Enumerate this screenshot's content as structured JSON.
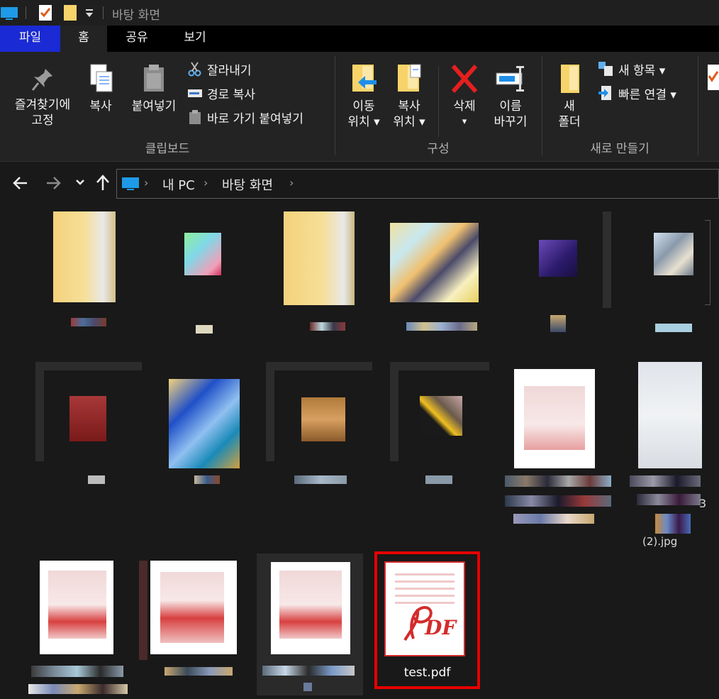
{
  "window": {
    "title": "바탕 화면"
  },
  "tabs": {
    "file": "파일",
    "home": "홈",
    "share": "공유",
    "view": "보기"
  },
  "ribbon": {
    "pin_label_1": "즐겨찾기에",
    "pin_label_2": "고정",
    "copy": "복사",
    "paste": "붙여넣기",
    "cut": "잘라내기",
    "copy_path": "경로 복사",
    "paste_shortcut": "바로 가기 붙여넣기",
    "clipboard_group": "클립보드",
    "move_to_1": "이동",
    "move_to_2": "위치 ▾",
    "copy_to_1": "복사",
    "copy_to_2": "위치 ▾",
    "delete": "삭제",
    "delete_arrow": "▾",
    "rename_1": "이름",
    "rename_2": "바꾸기",
    "organize_group": "구성",
    "new_folder_1": "새",
    "new_folder_2": "폴더",
    "new_item": "새 항목 ▾",
    "easy_access": "빠른 연결 ▾",
    "new_group": "새로 만들기"
  },
  "nav": {
    "back_icon": "back-arrow-icon",
    "forward_icon": "forward-arrow-icon",
    "recent_icon": "chevron-down-icon",
    "up_icon": "up-arrow-icon"
  },
  "breadcrumb": {
    "this_pc": "내 PC",
    "desktop": "바탕 화면"
  },
  "selected_file": {
    "name": "test.pdf"
  },
  "partial_labels": {
    "jpg_suffix": "(2).jpg",
    "digit": "3"
  },
  "colors": {
    "file_tab": "#1a2ad4",
    "selection": "#e60000",
    "pdf_red": "#d42b2b"
  }
}
